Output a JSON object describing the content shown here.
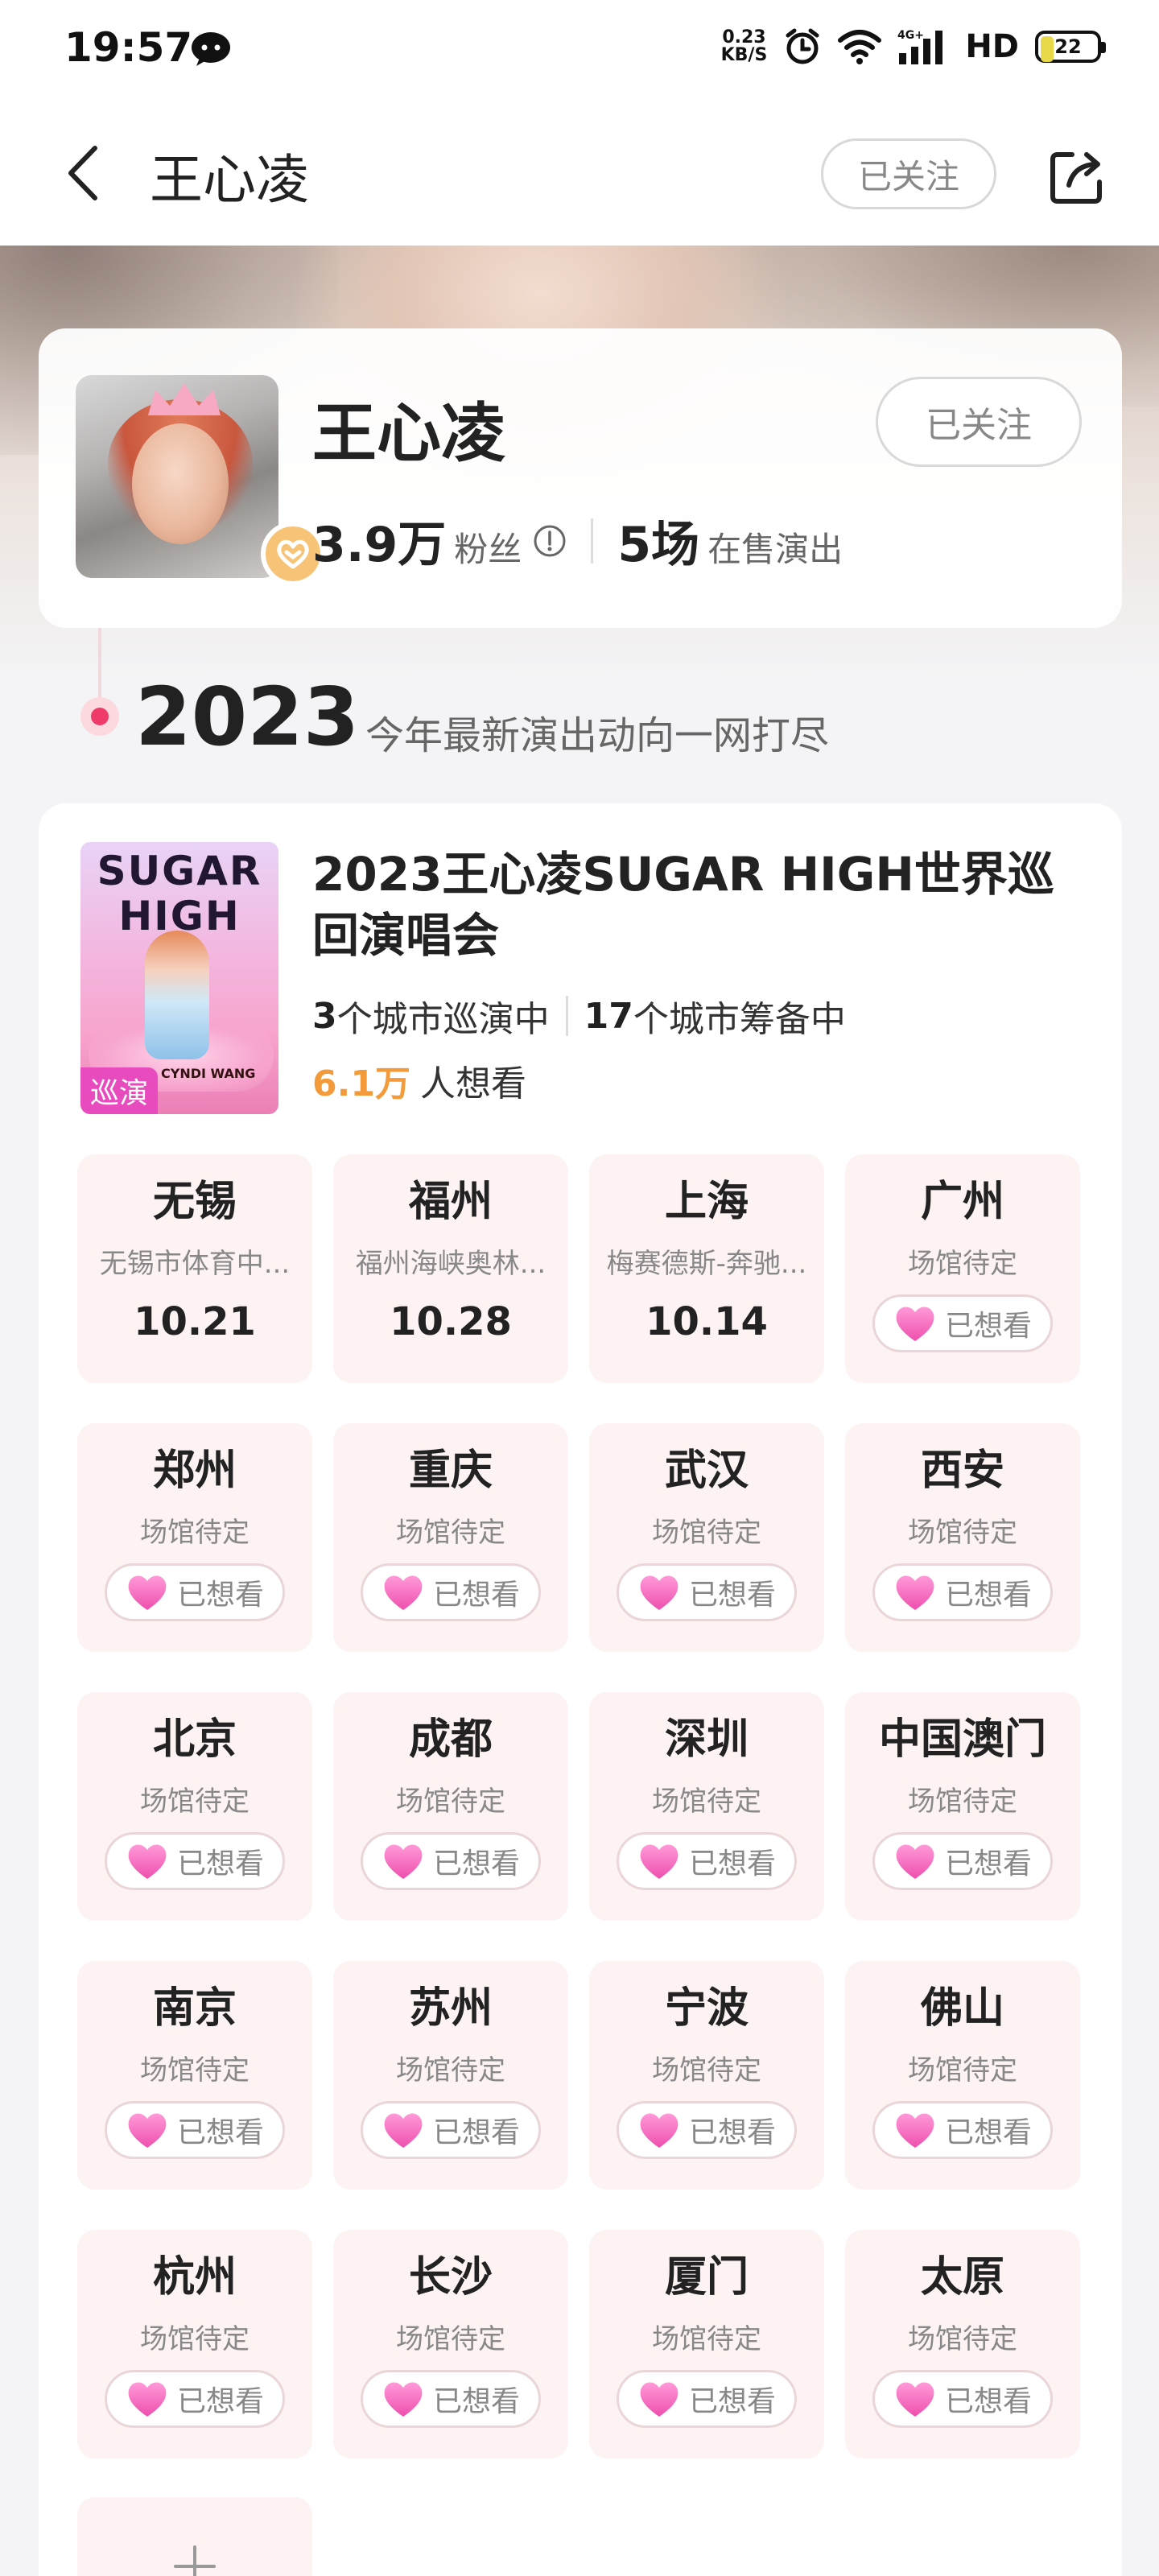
{
  "status_bar": {
    "time": "19:57",
    "net_speed_value": "0.23",
    "net_speed_unit": "KB/S",
    "hd": "HD",
    "battery": "22",
    "battery_level": 0.22,
    "icons": [
      "wechat-icon",
      "alarm-icon",
      "wifi-icon",
      "signal-4g-icon",
      "battery-icon"
    ]
  },
  "nav": {
    "title": "王心凌",
    "follow_label": "已关注",
    "icons": [
      "back-arrow-icon",
      "share-icon"
    ]
  },
  "artist": {
    "name": "王心凌",
    "follow_label": "已关注",
    "fans_count": "3.9万",
    "fans_label": "粉丝",
    "shows_count": "5场",
    "shows_label": "在售演出"
  },
  "timeline": {
    "year": "2023",
    "subtitle": "今年最新演出动向一网打尽"
  },
  "tour": {
    "poster_title_line1": "SUGAR",
    "poster_title_line2": "HIGH",
    "poster_subtitle": "CYNDI WANG",
    "tag": "巡演",
    "title": "2023王心凌SUGAR HIGH世界巡回演唱会",
    "touring_count": "3",
    "touring_label": "个城市巡演中",
    "preparing_count": "17",
    "preparing_label": "个城市筹备中",
    "want_count": "6.1万",
    "want_label": "人想看",
    "wanted_label": "已想看",
    "cities": [
      {
        "name": "无锡",
        "venue": "无锡市体育中...",
        "date": "10.21"
      },
      {
        "name": "福州",
        "venue": "福州海峡奥林...",
        "date": "10.28"
      },
      {
        "name": "上海",
        "venue": "梅赛德斯-奔驰...",
        "date": "10.14"
      },
      {
        "name": "广州",
        "venue": "场馆待定",
        "date": null
      },
      {
        "name": "郑州",
        "venue": "场馆待定",
        "date": null
      },
      {
        "name": "重庆",
        "venue": "场馆待定",
        "date": null
      },
      {
        "name": "武汉",
        "venue": "场馆待定",
        "date": null
      },
      {
        "name": "西安",
        "venue": "场馆待定",
        "date": null
      },
      {
        "name": "北京",
        "venue": "场馆待定",
        "date": null
      },
      {
        "name": "成都",
        "venue": "场馆待定",
        "date": null
      },
      {
        "name": "深圳",
        "venue": "场馆待定",
        "date": null
      },
      {
        "name": "中国澳门",
        "venue": "场馆待定",
        "date": null
      },
      {
        "name": "南京",
        "venue": "场馆待定",
        "date": null
      },
      {
        "name": "苏州",
        "venue": "场馆待定",
        "date": null
      },
      {
        "name": "宁波",
        "venue": "场馆待定",
        "date": null
      },
      {
        "name": "佛山",
        "venue": "场馆待定",
        "date": null
      },
      {
        "name": "杭州",
        "venue": "场馆待定",
        "date": null
      },
      {
        "name": "长沙",
        "venue": "场馆待定",
        "date": null
      },
      {
        "name": "厦门",
        "venue": "场馆待定",
        "date": null
      },
      {
        "name": "太原",
        "venue": "场馆待定",
        "date": null
      }
    ]
  },
  "colors": {
    "accent_pink": "#ee3b69",
    "want_orange": "#f39a3b",
    "heart_pink": "#f46cbf",
    "tag_magenta": "#e84bbd",
    "cell_bg": "#fdf3f3",
    "verified_gold": "#f6c377"
  }
}
